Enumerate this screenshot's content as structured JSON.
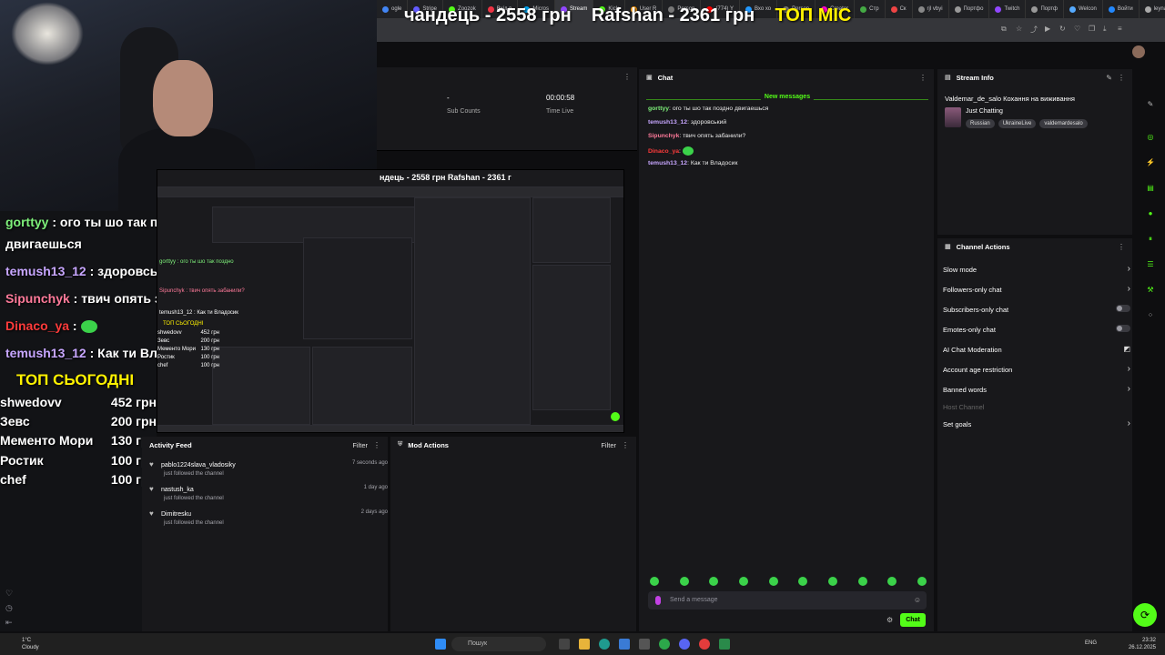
{
  "browser": {
    "tabs": [
      "ogle",
      "Stripe",
      "Zoozok",
      "Вхід в",
      "Micros",
      "Stream",
      "Kick",
      "User R",
      "Person",
      "(774) Y",
      "Вхо хо",
      "Person",
      "Creator",
      "Стр",
      "Ск",
      "rjl vbyi",
      "Портфо",
      "Twitch",
      "Портф",
      "Welcon",
      "Войти",
      "leyna V"
    ],
    "ticker_parts": [
      "чандець  -  2558 грн",
      "Rafshan  -  2361 грн",
      "ТОП МІС"
    ]
  },
  "overlay": {
    "messages": [
      {
        "user": "gorttyy",
        "text": " : ого ты шо так поздно"
      },
      {
        "user": "",
        "text": "двигаешься"
      },
      {
        "user": "temush13_12",
        "text": " : здоровський"
      },
      {
        "user": "Sipunchyk",
        "text": " : твич опять забанили?"
      },
      {
        "user": "Dinaco_ya",
        "text": " : "
      },
      {
        "user": "temush13_12",
        "text": " : Как ти Владосик"
      }
    ],
    "top_title": "ТОП СЬОГОДНІ",
    "top": [
      {
        "name": "shwedovv",
        "amount": "452 грн"
      },
      {
        "name": "Зевс",
        "amount": "200 грн"
      },
      {
        "name": "Мементо Мори",
        "amount": "130 грн"
      },
      {
        "name": "Ростик",
        "amount": "100 грн"
      },
      {
        "name": "chef",
        "amount": "100 грн"
      }
    ]
  },
  "stats": {
    "sub_value": "-",
    "sub_label": "Sub Counts",
    "time_value": "00:00:58",
    "time_label": "Time Live"
  },
  "nested": {
    "ticker": "ндець  -  2558 грн   Rafshan  -  2361 г",
    "top_title": "ТОП СЬОГОДНІ",
    "rows": [
      {
        "name": "shwedovv",
        "amount": "452 грн"
      },
      {
        "name": "Зевс",
        "amount": "200 грн"
      },
      {
        "name": "Мементо Мори",
        "amount": "130 грн"
      },
      {
        "name": "Ростик",
        "amount": "100 грн"
      },
      {
        "name": "chef",
        "amount": "100 грн"
      }
    ],
    "msgs": [
      "gorttyy : ого ты шо так поздно",
      "Sipunchyk : твич опять забанили?",
      "temush13_12 : Как ти Владосик"
    ]
  },
  "activity": {
    "title": "Activity Feed",
    "filter": "Filter",
    "items": [
      {
        "name": "pablo1224slava_vladosiky",
        "sub": "just followed the channel",
        "time": "7 seconds ago"
      },
      {
        "name": "nastush_ka",
        "sub": "just followed the channel",
        "time": "1 day ago"
      },
      {
        "name": "Dimitresku",
        "sub": "just followed the channel",
        "time": "2 days ago"
      }
    ]
  },
  "mod": {
    "title": "Mod Actions",
    "filter": "Filter"
  },
  "chat": {
    "title": "Chat",
    "new_messages": "New messages",
    "lines": [
      {
        "user": "gorttyy",
        "text": ": ого ты шо так поздно двигаешься",
        "color": "#7ef07a"
      },
      {
        "user": "temush13_12",
        "text": ": здоровський",
        "color": "#c7a6ff"
      },
      {
        "user": "Sipunchyk",
        "text": ": твич опять забанили?",
        "color": "#ff7a9a"
      },
      {
        "user": "Dinaco_ya",
        "text": ":",
        "color": "#ff3b3b"
      },
      {
        "user": "temush13_12",
        "text": ": Как ти Владосик",
        "color": "#c7a6ff"
      }
    ],
    "placeholder": "Send a message",
    "send_label": "Chat"
  },
  "stream_info": {
    "title": "Stream Info",
    "stream_title": "Valdemar_de_salo Кохання на виживання",
    "category": "Just Chatting",
    "tags": [
      "Russian",
      "UkraineLive",
      "valdemardesalo"
    ]
  },
  "channel_actions": {
    "title": "Channel Actions",
    "items": [
      {
        "label": "Slow mode",
        "control": "chevron"
      },
      {
        "label": "Followers-only chat",
        "control": "chevron"
      },
      {
        "label": "Subscribers-only chat",
        "control": "toggle"
      },
      {
        "label": "Emotes-only chat",
        "control": "toggle"
      },
      {
        "label": "AI Chat Moderation",
        "control": "gauge"
      },
      {
        "label": "Account age restriction",
        "control": "chevron"
      },
      {
        "label": "Banned words",
        "control": "chevron"
      },
      {
        "label": "Host Channel",
        "control": "none"
      },
      {
        "label": "Set goals",
        "control": "chevron"
      }
    ]
  },
  "taskbar": {
    "weather_temp": "1°C",
    "weather_desc": "Cloudy",
    "search_placeholder": "Пошук",
    "lang": "ENG",
    "time": "23:32",
    "date": "26.12.2025"
  },
  "colors": {
    "accent": "#53fc18",
    "bg": "#0e0e10",
    "panel": "#18181b",
    "ticker_highlight": "#fff200"
  }
}
